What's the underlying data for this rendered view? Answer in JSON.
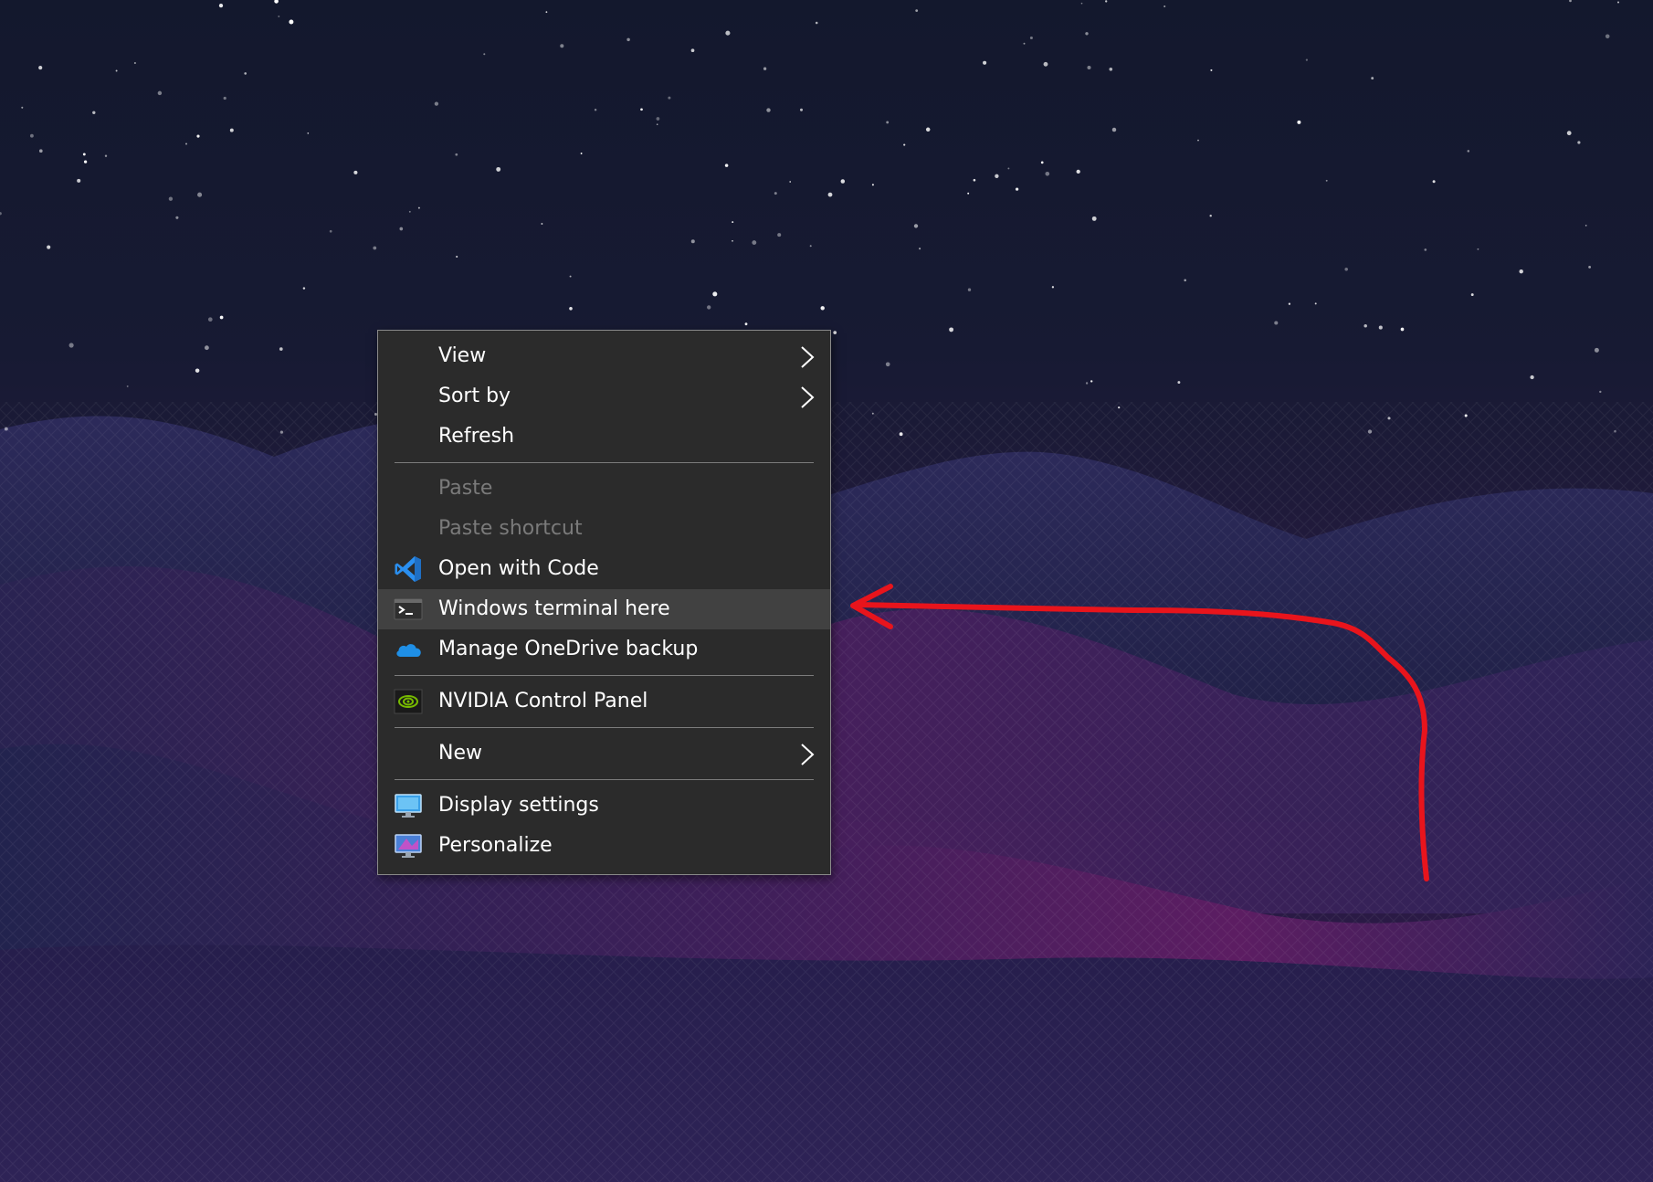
{
  "desktop": {
    "wallpaper": "starry-night-purple-mountains"
  },
  "context_menu": {
    "items": {
      "view": {
        "label": "View",
        "icon": "none",
        "submenu": true
      },
      "sort_by": {
        "label": "Sort by",
        "icon": "none",
        "submenu": true
      },
      "refresh": {
        "label": "Refresh",
        "icon": "none"
      },
      "paste": {
        "label": "Paste",
        "icon": "none",
        "disabled": true
      },
      "paste_shortcut": {
        "label": "Paste shortcut",
        "icon": "none",
        "disabled": true
      },
      "open_with_code": {
        "label": "Open with Code",
        "icon": "vscode-icon"
      },
      "windows_terminal": {
        "label": "Windows terminal here",
        "icon": "terminal-icon",
        "highlighted": true
      },
      "onedrive": {
        "label": "Manage OneDrive backup",
        "icon": "onedrive-cloud-icon"
      },
      "nvidia": {
        "label": "NVIDIA Control Panel",
        "icon": "nvidia-icon"
      },
      "new": {
        "label": "New",
        "icon": "none",
        "submenu": true
      },
      "display_settings": {
        "label": "Display settings",
        "icon": "display-settings-icon"
      },
      "personalize": {
        "label": "Personalize",
        "icon": "personalize-icon"
      }
    }
  },
  "annotation": {
    "arrow_color": "#e8141c",
    "points_to": "Windows terminal here"
  },
  "colors": {
    "menu_bg": "#2b2b2b",
    "menu_highlight": "#414141",
    "menu_text": "#ffffff",
    "menu_disabled_text": "#7a7a7a",
    "vscode_blue": "#2a8ff0",
    "onedrive_blue": "#1f8fe6",
    "nvidia_green": "#76b900"
  }
}
